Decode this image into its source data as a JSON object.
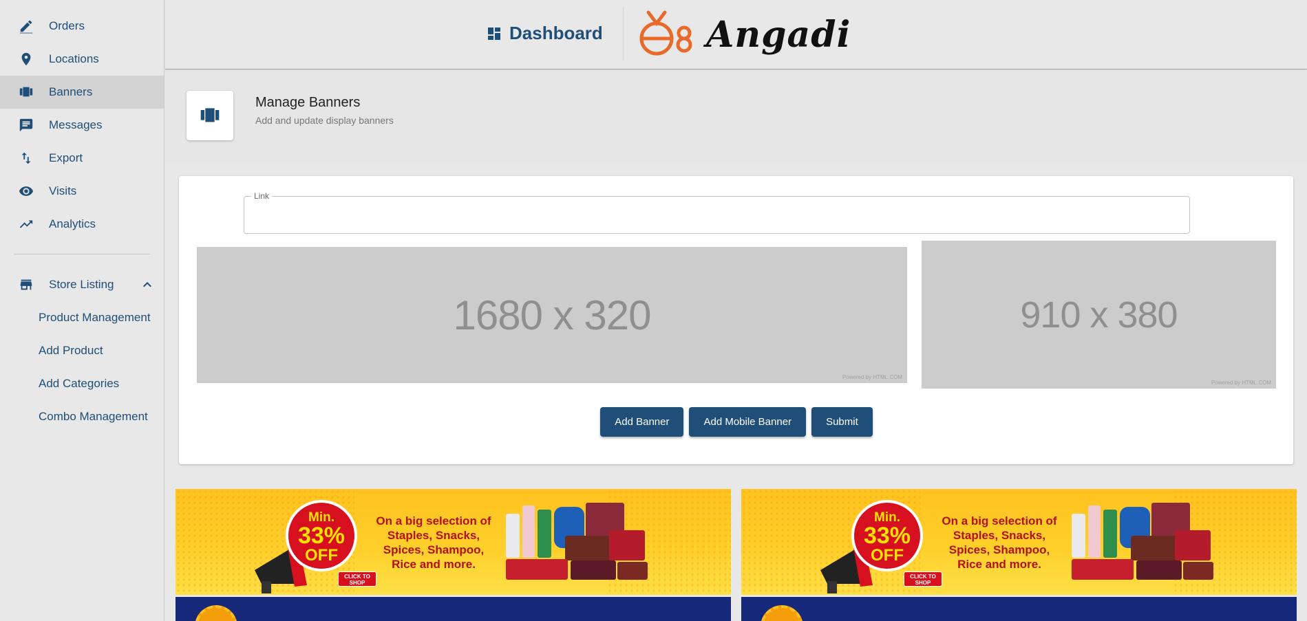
{
  "sidebar": {
    "items": [
      {
        "label": "Orders",
        "icon": "pencil-icon"
      },
      {
        "label": "Locations",
        "icon": "location-pin-icon"
      },
      {
        "label": "Banners",
        "icon": "carousel-icon"
      },
      {
        "label": "Messages",
        "icon": "chat-icon"
      },
      {
        "label": "Export",
        "icon": "import-export-icon"
      },
      {
        "label": "Visits",
        "icon": "eye-icon"
      },
      {
        "label": "Analytics",
        "icon": "trending-up-icon"
      }
    ],
    "active_index": 2,
    "group": {
      "label": "Store Listing",
      "icon": "store-icon",
      "expanded": true,
      "children": [
        "Product Management",
        "Add Product",
        "Add Categories",
        "Combo Management"
      ]
    }
  },
  "topbar": {
    "dashboard_label": "Dashboard",
    "brand_name": "Angadi"
  },
  "page_header": {
    "title": "Manage Banners",
    "subtitle": "Add and update display banners"
  },
  "form": {
    "link_label": "Link",
    "link_value": "",
    "desktop_placeholder": "1680 x 320",
    "mobile_placeholder": "910 x 380",
    "powered_by": "Powered by HTML.COM",
    "powered_by_short": "Powered by HTML.COM",
    "buttons": {
      "add_banner": "Add Banner",
      "add_mobile_banner": "Add Mobile Banner",
      "submit": "Submit"
    }
  },
  "banners": [
    {
      "min": "Min.",
      "pct": "33%",
      "off": "OFF",
      "headline": "On a big selection of Staples, Snacks, Spices, Shampoo, Rice and more.",
      "cta": "CLICK TO SHOP"
    },
    {
      "min": "Min.",
      "pct": "33%",
      "off": "OFF",
      "headline": "On a big selection of Staples, Snacks, Spices, Shampoo, Rice and more.",
      "cta": "CLICK TO SHOP"
    }
  ],
  "colors": {
    "primary": "#1f4e79",
    "sidebar_bg": "#e8e8e8",
    "active_bg": "#d3d3d3",
    "logo_orange": "#e8692a",
    "banner_yellow": "#ffc21f",
    "banner_red": "#d6101f",
    "banner_dark": "#16287a"
  }
}
